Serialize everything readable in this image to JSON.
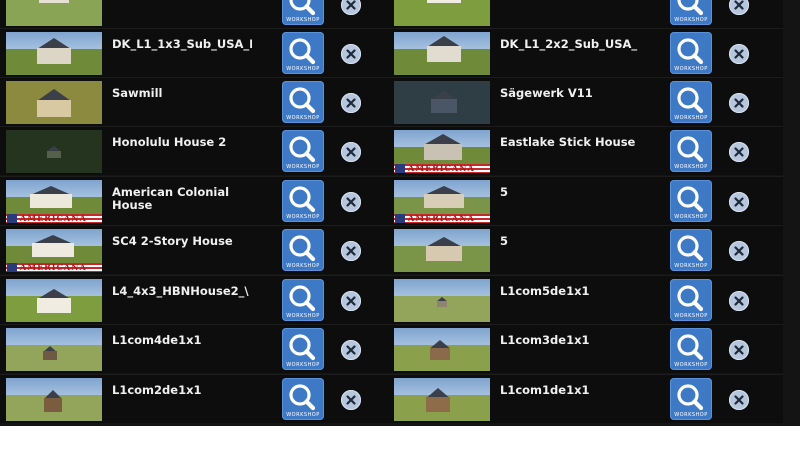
{
  "workshop_caption": "WORKSHOP",
  "icons": {
    "workshop": "magnifier-icon",
    "remove": "close-x-icon"
  },
  "colors": {
    "panel": "#141414",
    "workshop_button": "#3e79c6",
    "remove_button": "#b6c6dd",
    "title_text": "#f0f0f0"
  },
  "items": [
    {
      "title": "",
      "banner": ""
    },
    {
      "title": "",
      "banner": ""
    },
    {
      "title": "DK_L1_1x3_Sub_USA_I",
      "banner": ""
    },
    {
      "title": "DK_L1_2x2_Sub_USA_",
      "banner": ""
    },
    {
      "title": "Sawmill",
      "banner": ""
    },
    {
      "title": "Sägewerk V11",
      "banner": ""
    },
    {
      "title": "Honolulu House 2",
      "banner": ""
    },
    {
      "title": "Eastlake Stick House",
      "banner": "AMERICANA"
    },
    {
      "title": "American Colonial House",
      "banner": "AMERICANA"
    },
    {
      "title": "5",
      "banner": "AMERICANA"
    },
    {
      "title": "SC4 2-Story House",
      "banner": "AMERICANA"
    },
    {
      "title": "5",
      "banner": ""
    },
    {
      "title": "L4_4x3_HBNHouse2_\\",
      "banner": ""
    },
    {
      "title": "L1com5de1x1",
      "banner": ""
    },
    {
      "title": "L1com4de1x1",
      "banner": ""
    },
    {
      "title": "L1com3de1x1",
      "banner": ""
    },
    {
      "title": "L1com2de1x1",
      "banner": ""
    },
    {
      "title": "L1com1de1x1",
      "banner": ""
    }
  ]
}
